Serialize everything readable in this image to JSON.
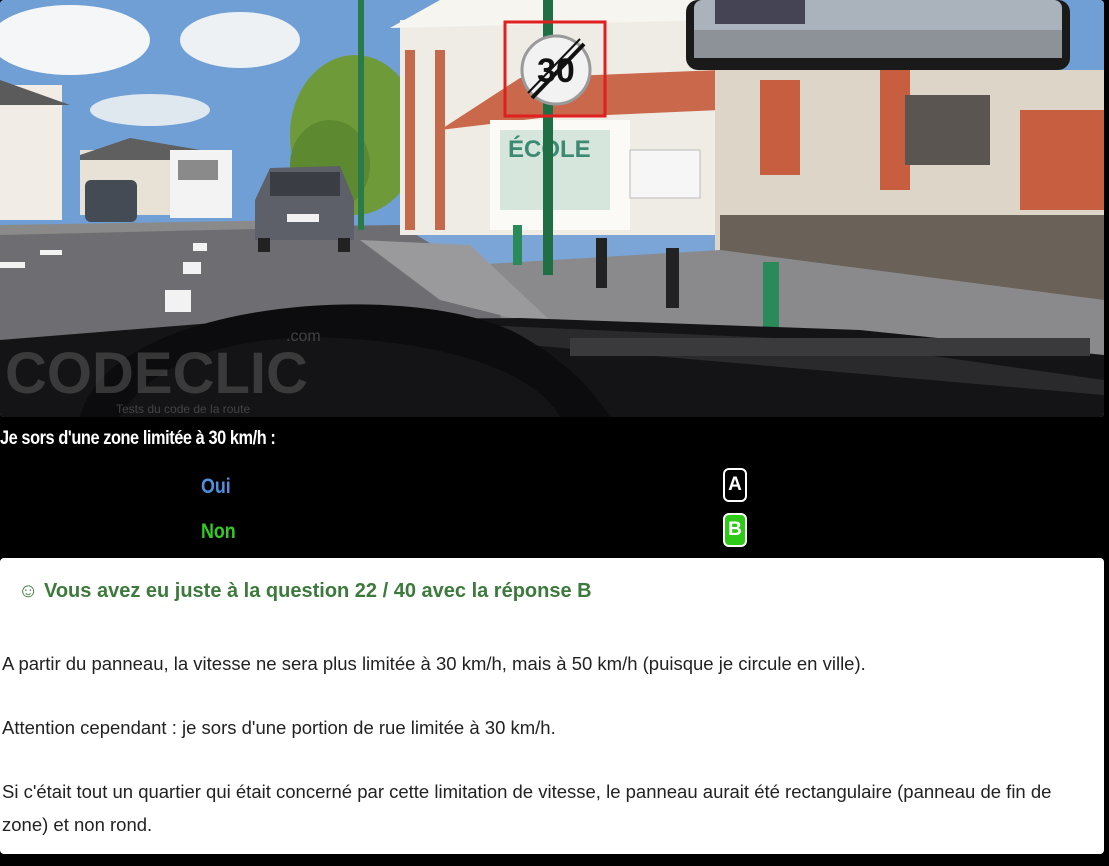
{
  "scene": {
    "watermark_brand": "CODECLIC",
    "watermark_domain": ".com",
    "watermark_tagline": "Tests du code de la route",
    "school_sign_text": "ÉCOLE",
    "speed_sign_value": "30",
    "colors": {
      "sky": "#7aa5d6",
      "highlight_box": "#e02020"
    }
  },
  "question": {
    "text": "Je sors d'une zone limitée à 30 km/h :"
  },
  "answers": [
    {
      "label": "Oui",
      "letter": "A",
      "selected": false,
      "color": "#4f8fe0"
    },
    {
      "label": "Non",
      "letter": "B",
      "selected": true,
      "color": "#33cc22"
    }
  ],
  "feedback": {
    "title": "☺ Vous avez eu juste à la question 22 / 40 avec la réponse B",
    "paragraph1": "A partir du panneau, la vitesse ne sera plus limitée à 30 km/h, mais à 50 km/h (puisque je circule en ville).",
    "paragraph2": "Attention cependant : je sors d'une portion de rue limitée à 30 km/h.",
    "paragraph3": "Si c'était tout un quartier qui était concerné par cette limitation de vitesse, le panneau aurait été rectangulaire (panneau de fin de zone) et non rond.",
    "title_color": "#3c7a3c"
  }
}
